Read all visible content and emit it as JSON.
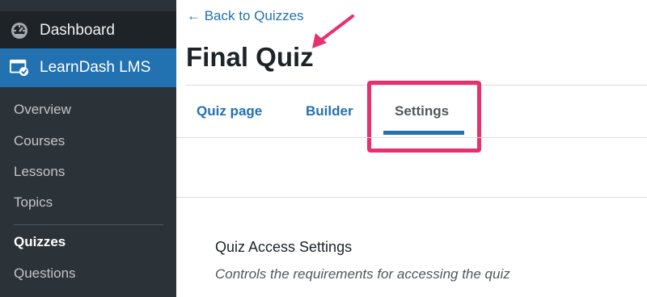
{
  "sidebar": {
    "dashboard_label": "Dashboard",
    "learndash_label": "LearnDash LMS",
    "items": [
      {
        "label": "Overview"
      },
      {
        "label": "Courses"
      },
      {
        "label": "Lessons"
      },
      {
        "label": "Topics"
      },
      {
        "label": "Quizzes"
      },
      {
        "label": "Questions"
      }
    ],
    "icons": {
      "dashboard": "dashboard-gauge-icon",
      "learndash": "learndash-window-check-icon"
    }
  },
  "header": {
    "back_link": "← Back to Quizzes",
    "title": "Final Quiz"
  },
  "tabs": [
    {
      "label": "Quiz page"
    },
    {
      "label": "Builder"
    },
    {
      "label": "Settings"
    }
  ],
  "section": {
    "title": "Quiz Access Settings",
    "description": "Controls the requirements for accessing the quiz"
  },
  "colors": {
    "sidebar_bg": "#2c3338",
    "accent": "#2271b1",
    "annotation": "#e8306d"
  }
}
